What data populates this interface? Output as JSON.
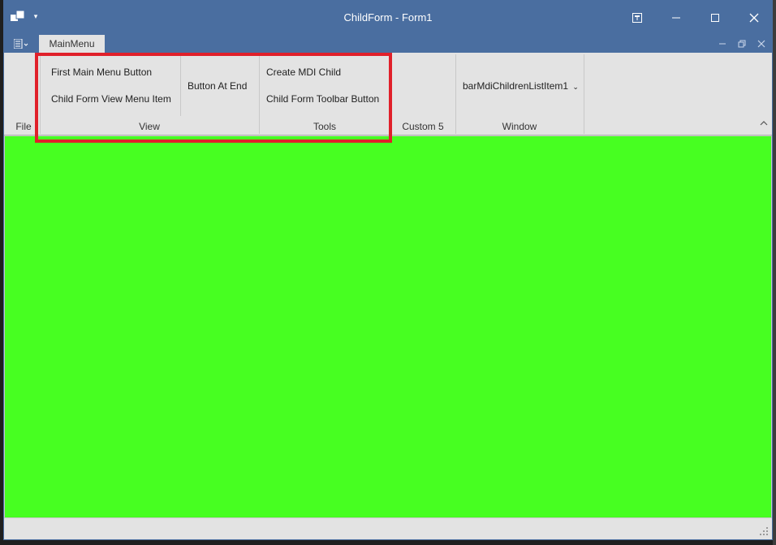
{
  "window": {
    "title": "ChildForm - Form1"
  },
  "tabs": [
    {
      "label": "MainMenu"
    }
  ],
  "ribbon": {
    "file_label": "File",
    "view_group": {
      "label": "View",
      "items": [
        "First Main Menu Button",
        "Child Form View Menu Item",
        "Button At End"
      ]
    },
    "tools_group": {
      "label": "Tools",
      "items": [
        "Create MDI Child",
        "Child Form Toolbar Button"
      ]
    },
    "custom_group": {
      "label": "Custom 5"
    },
    "window_group": {
      "label": "Window",
      "items": [
        "barMdiChildrenListItem1"
      ]
    }
  },
  "colors": {
    "titlebar": "#4a6ea0",
    "ribbon": "#e3e3e3",
    "client": "#47ff21",
    "highlight": "#e0202a"
  },
  "icons": [
    "app-icon",
    "dropdown-icon",
    "restore-icon",
    "minimize-icon",
    "maximize-icon",
    "close-icon",
    "menu-icon",
    "chevron-up-icon",
    "resize-grip-icon"
  ]
}
